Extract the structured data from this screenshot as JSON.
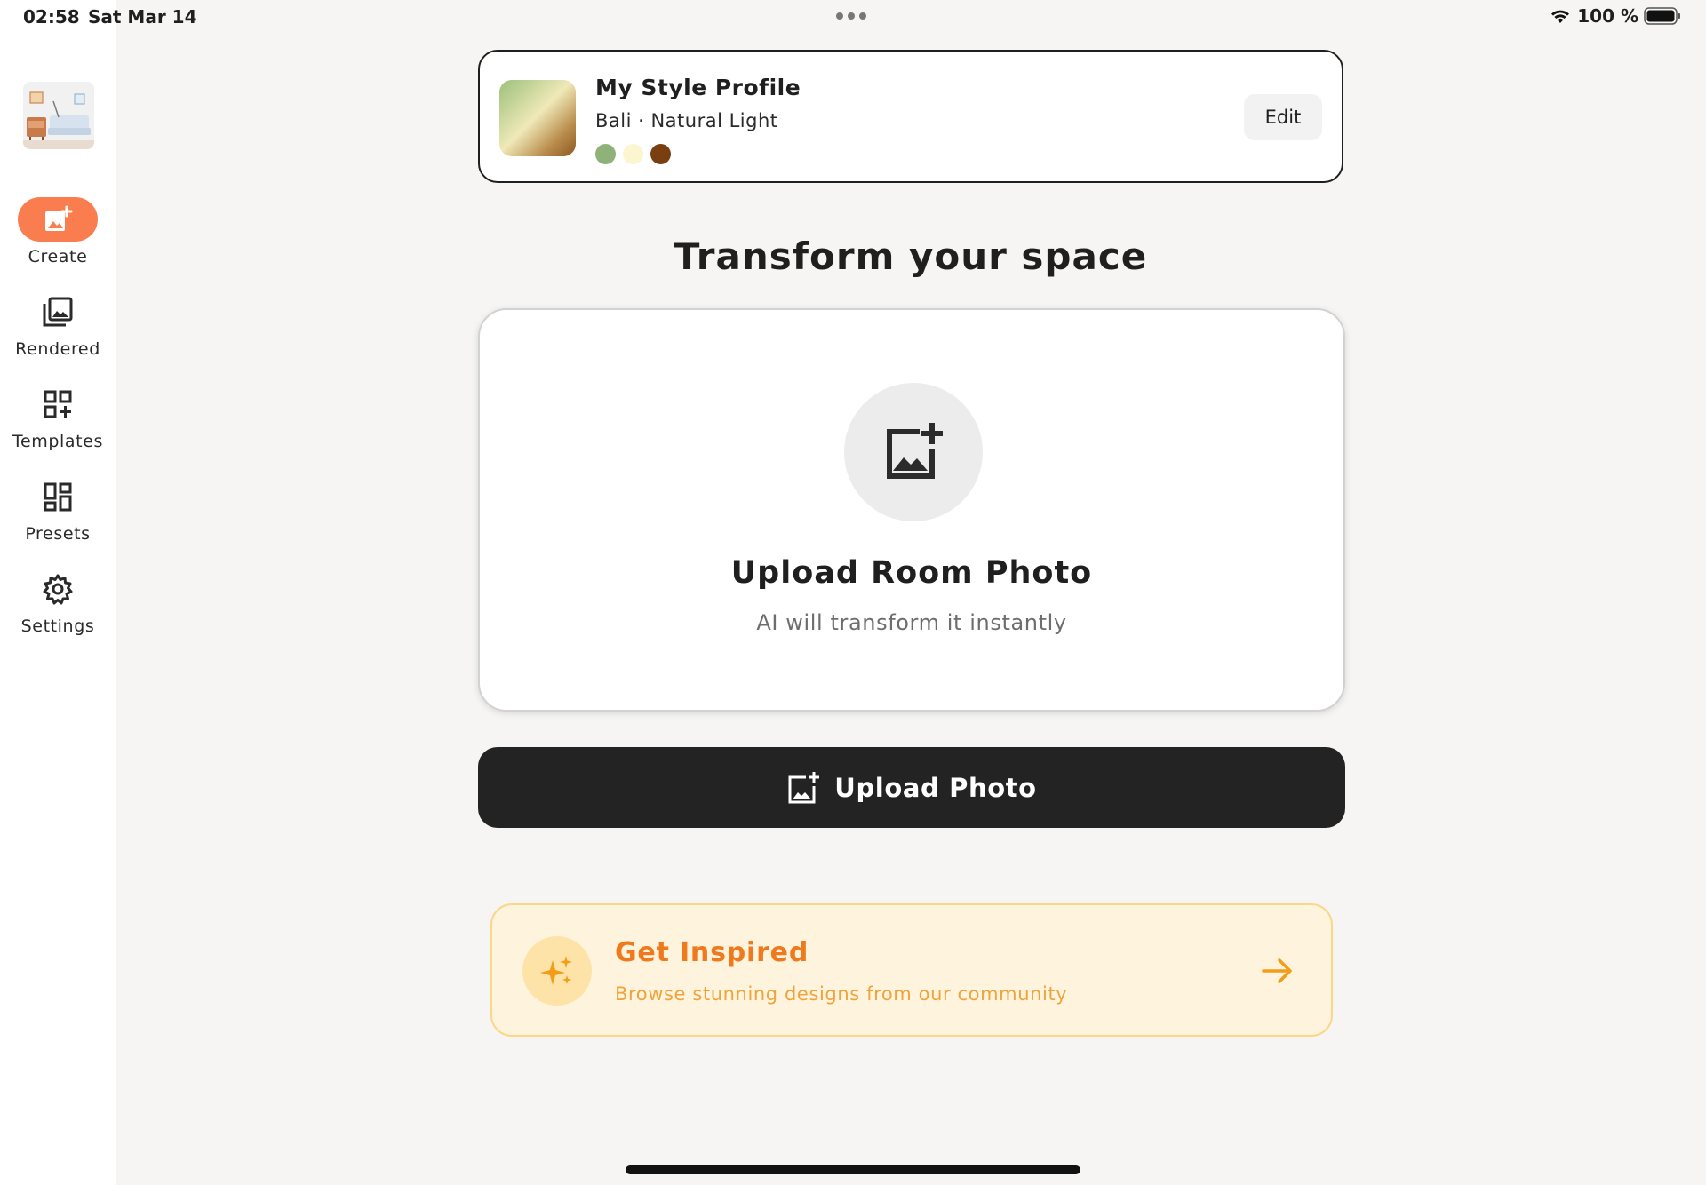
{
  "status_bar": {
    "time": "02:58",
    "date": "Sat Mar 14",
    "battery": "100 %",
    "icons": [
      "wifi-icon",
      "battery-icon"
    ]
  },
  "sidebar": {
    "items": [
      {
        "label": "Create",
        "icon": "add-photo-icon",
        "active": true
      },
      {
        "label": "Rendered",
        "icon": "photo-library-icon"
      },
      {
        "label": "Templates",
        "icon": "grid-add-icon"
      },
      {
        "label": "Presets",
        "icon": "dashboard-icon"
      },
      {
        "label": "Settings",
        "icon": "gear-icon"
      }
    ]
  },
  "style_profile": {
    "title": "My Style Profile",
    "subtitle": "Bali · Natural Light",
    "palette": [
      "#8fb27a",
      "#fbf6cf",
      "#7a3f10"
    ],
    "edit_label": "Edit"
  },
  "main": {
    "heading": "Transform your space",
    "upload_card": {
      "title": "Upload Room Photo",
      "subtitle": "AI will transform it instantly",
      "icon": "add-photo-icon"
    },
    "upload_button": {
      "label": "Upload Photo",
      "icon": "add-photo-icon"
    }
  },
  "inspired": {
    "title": "Get Inspired",
    "subtitle": "Browse stunning designs from our community",
    "icon": "sparkles-icon",
    "arrow": "arrow-right-icon"
  },
  "colors": {
    "accent": "#f97d4f",
    "primary_button": "#232323",
    "inspired_bg": "#fef3dd",
    "inspired_text": "#ef7a1e"
  }
}
